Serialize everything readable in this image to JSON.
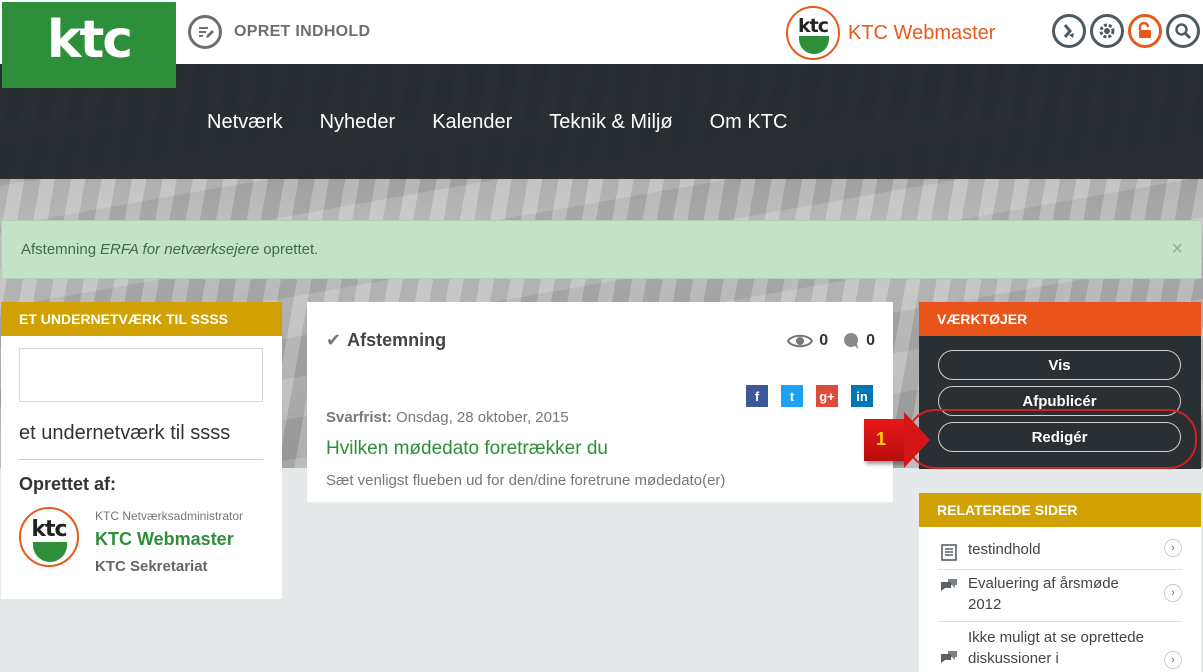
{
  "logo": {
    "text": "ktc"
  },
  "topbar": {
    "create_label": "OPRET INDHOLD",
    "user_name": "KTC Webmaster",
    "avatar_text": "ktc"
  },
  "nav": {
    "items": [
      "Netværk",
      "Nyheder",
      "Kalender",
      "Teknik & Miljø",
      "Om KTC"
    ]
  },
  "alert": {
    "prefix": "Afstemning",
    "italic": "ERFA for netværksejere",
    "suffix": "oprettet.",
    "close": "×"
  },
  "left_panel": {
    "header": "ET UNDERNETVÆRK TIL SSSS",
    "title": "et undernetværk til ssss",
    "created_by_label": "Oprettet af:",
    "avatar_text": "ktc",
    "role": "KTC Netværksadministrator",
    "name": "KTC Webmaster",
    "org": "KTC Sekretariat"
  },
  "card": {
    "type_label": "Afstemning",
    "views": "0",
    "comments": "0",
    "deadline_label": "Svarfrist:",
    "deadline_value": "Onsdag, 28 oktober, 2015",
    "poll_title": "Hvilken mødedato foretrækker du",
    "poll_desc": "Sæt venligst flueben ud for den/dine foretrune mødedato(er)",
    "social": [
      {
        "label": "f",
        "color": "#3b5998"
      },
      {
        "label": "t",
        "color": "#1da1f2"
      },
      {
        "label": "g+",
        "color": "#dd4b39"
      },
      {
        "label": "in",
        "color": "#0077b5"
      }
    ]
  },
  "tools_panel": {
    "header": "VÆRKTØJER",
    "buttons": [
      "Vis",
      "Afpublicér",
      "Redigér"
    ],
    "marker": "1"
  },
  "related_panel": {
    "header": "RELATEREDE SIDER",
    "items": [
      "testindhold",
      "Evaluering af årsmøde 2012",
      "Ikke muligt at se oprettede diskussioner i"
    ]
  },
  "colors": {
    "green": "#2e8f3a",
    "orange": "#e8541a",
    "gold": "#d2a103",
    "dark": "#2a2f33"
  }
}
